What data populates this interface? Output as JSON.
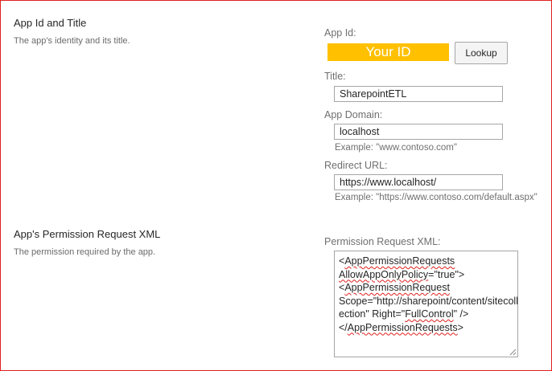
{
  "section_app_id": {
    "title": "App Id and Title",
    "description": "The app's identity and its title."
  },
  "app_id": {
    "label": "App Id:",
    "value": "Your ID",
    "lookup_label": "Lookup",
    "highlight_color": "#ffc000"
  },
  "title_field": {
    "label": "Title:",
    "value": "SharepointETL"
  },
  "app_domain": {
    "label": "App Domain:",
    "value": "localhost",
    "example": "Example: \"www.contoso.com\""
  },
  "redirect_url": {
    "label": "Redirect URL:",
    "value": "https://www.localhost/",
    "example": "Example: \"https://www.contoso.com/default.aspx\""
  },
  "section_permission": {
    "title": "App's Permission Request XML",
    "description": "The permission required by the app."
  },
  "permission_xml": {
    "label": "Permission Request XML:",
    "line1_pre": "<",
    "line1_word": "AppPermissionRequests",
    "line2_word": "AllowAppOnlyPolicy",
    "line2_post": "=\"true\">",
    "line3_pre": "<",
    "line3_word": "AppPermissionRequest",
    "line4": "Scope=\"http://sharepoint/content/sitecoll",
    "line5_pre": "ection\" Right=\"",
    "line5_word": "FullControl",
    "line5_post": "\" />",
    "line6_pre": "</",
    "line6_word": "AppPermissionRequests",
    "line6_post": ">"
  },
  "colors": {
    "border_accent": "#e0201f",
    "spellcheck": "#e0201f"
  }
}
